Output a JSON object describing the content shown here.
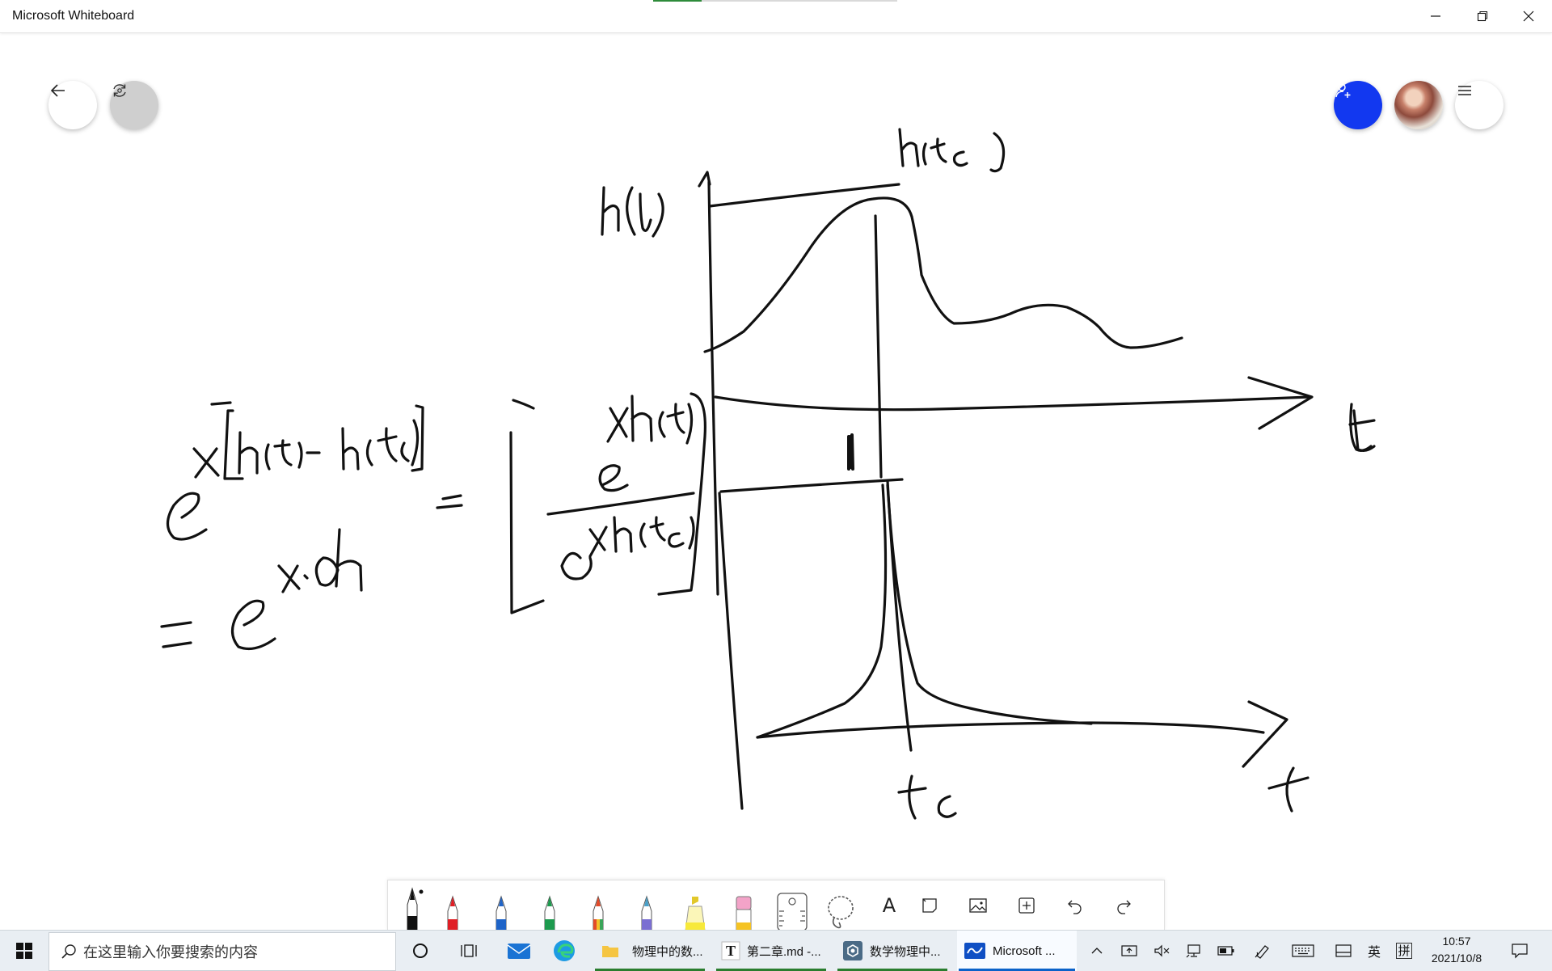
{
  "window": {
    "title": "Microsoft Whiteboard",
    "minimize_icon": "minimize-icon",
    "restore_icon": "restore-icon",
    "close_icon": "close-icon"
  },
  "whiteboard": {
    "buttons": {
      "back": "back-arrow-icon",
      "sync": "sync-icon",
      "invite": "add-person-icon",
      "menu": "hamburger-menu-icon"
    },
    "ink_color": "#111111",
    "accent_blue": "#1238f0"
  },
  "pen_toolbar": {
    "tools": [
      {
        "name": "pen-black",
        "color": "#111111"
      },
      {
        "name": "pen-red",
        "color": "#e01e25"
      },
      {
        "name": "pen-blue",
        "color": "#1f64c8"
      },
      {
        "name": "pen-green",
        "color": "#1d9a4e"
      },
      {
        "name": "pen-rainbow",
        "color": "#e34b2a"
      },
      {
        "name": "pen-galaxy",
        "color": "#6b7bd6"
      },
      {
        "name": "highlighter-yellow",
        "color": "#f7e93a"
      },
      {
        "name": "eraser",
        "color": "#f3a3c8"
      },
      {
        "name": "ruler",
        "color": "#555555"
      },
      {
        "name": "lasso-select",
        "color": "#555555"
      }
    ],
    "text_tool_label": "A",
    "icons": [
      "note-icon",
      "image-icon",
      "add-icon",
      "undo-icon",
      "redo-icon"
    ]
  },
  "taskbar": {
    "search_placeholder": "在这里输入你要搜索的内容",
    "apps": [
      {
        "label": "物理中的数...",
        "icon": "folder-icon"
      },
      {
        "label": "第二章.md -...",
        "icon": "typora-icon"
      },
      {
        "label": "数学物理中...",
        "icon": "app-icon"
      },
      {
        "label": "Microsoft ...",
        "icon": "whiteboard-icon"
      }
    ],
    "ime_lang": "英",
    "ime_mode": "拼",
    "clock_time": "10:57",
    "clock_date": "2021/10/8"
  }
}
